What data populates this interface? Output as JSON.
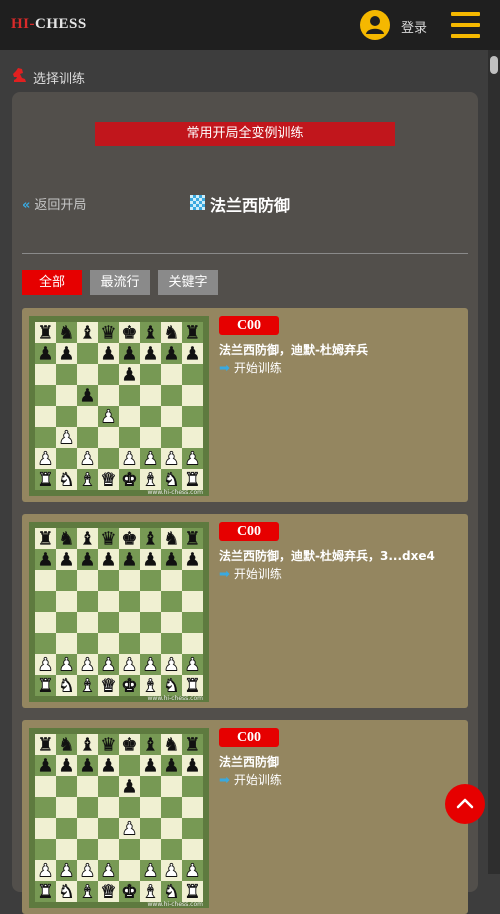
{
  "header": {
    "logo_prefix": "HI-",
    "logo_suffix": "CHESS",
    "login_label": "登录",
    "avatar_icon": "user-avatar-icon",
    "menu_icon": "hamburger-menu-icon"
  },
  "section": {
    "title": "选择训练",
    "icon": "knight-icon"
  },
  "banner": {
    "label": "常用开局全变例训练"
  },
  "nav": {
    "back_label": "返回开局",
    "opening_title": "法兰西防御",
    "title_icon": "chessboard-icon"
  },
  "filters": [
    {
      "label": "全部",
      "active": true
    },
    {
      "label": "最流行",
      "active": false
    },
    {
      "label": "关键字",
      "active": false
    }
  ],
  "cards": [
    {
      "eco": "C00",
      "variation": "法兰西防御，迪默-杜姆弃兵",
      "start_label": "开始训练",
      "watermark": "www.hi-chess.com",
      "board": [
        "rnbqkbnr",
        "pp.ppppp",
        "....p...",
        "..p.....",
        "...P....",
        ".P......",
        "P.P.PPPP",
        "RNBQKBNR"
      ]
    },
    {
      "eco": "C00",
      "variation": "法兰西防御，迪默-杜姆弃兵，3...dxe4",
      "start_label": "开始训练",
      "watermark": "www.hi-chess.com",
      "board": [
        "rnbqkbnr",
        "pppppppp",
        "........",
        "........",
        "........",
        "........",
        "PPPPPPPP",
        "RNBQKBNR"
      ]
    },
    {
      "eco": "C00",
      "variation": "法兰西防御",
      "start_label": "开始训练",
      "watermark": "www.hi-chess.com",
      "board": [
        "rnbqkbnr",
        "pppp.ppp",
        "....p...",
        "........",
        "....P...",
        "........",
        "PPPP.PPP",
        "RNBQKBNR"
      ]
    }
  ],
  "colors": {
    "accent_red": "#e60000",
    "banner_red": "#c1161c",
    "card_bg": "#948660",
    "board_light": "#f0f0d2",
    "board_dark": "#779954",
    "link_blue": "#39a9e0",
    "avatar_yellow": "#f5b800"
  },
  "back_to_top_icon": "chevron-up-icon"
}
